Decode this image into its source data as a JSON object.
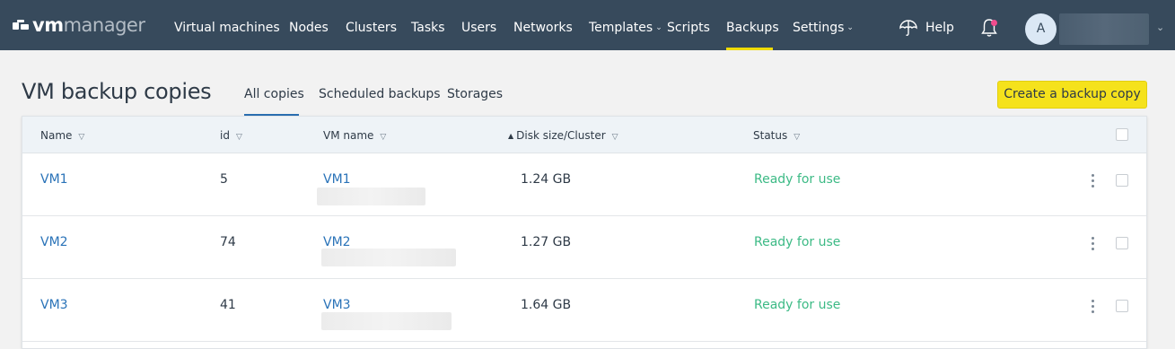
{
  "header": {
    "logo_vm": "vm",
    "logo_manager": "manager",
    "nav": [
      {
        "label": "Virtual machines"
      },
      {
        "label": "Nodes"
      },
      {
        "label": "Clusters"
      },
      {
        "label": "Tasks"
      },
      {
        "label": "Users"
      },
      {
        "label": "Networks"
      },
      {
        "label": "Templates",
        "dropdown": true
      },
      {
        "label": "Scripts"
      },
      {
        "label": "Backups",
        "active": true
      },
      {
        "label": "Settings",
        "dropdown": true
      }
    ],
    "help_label": "Help",
    "avatar_initial": "A",
    "notification_dot_color": "#f24c8e",
    "accent_color": "#f0dc00",
    "bar_color": "#374a5c"
  },
  "page": {
    "title": "VM backup copies",
    "tabs": [
      {
        "label": "All copies",
        "active": true
      },
      {
        "label": "Scheduled backups"
      },
      {
        "label": "Storages"
      }
    ],
    "create_button": "Create a backup copy"
  },
  "table": {
    "columns": [
      "Name",
      "id",
      "VM name",
      "Disk size/Cluster",
      "Status"
    ],
    "sorted_column": "Disk size/Cluster",
    "sort_direction": "ascending",
    "rows": [
      {
        "name": "VM1",
        "id": "5",
        "vm_name": "VM1",
        "disk_size": "1.24 GB",
        "status": "Ready for use"
      },
      {
        "name": "VM2",
        "id": "74",
        "vm_name": "VM2",
        "disk_size": "1.27 GB",
        "status": "Ready for use"
      },
      {
        "name": "VM3",
        "id": "41",
        "vm_name": "VM3",
        "disk_size": "1.64 GB",
        "status": "Ready for use"
      }
    ],
    "status_color": "#3cba85",
    "link_color": "#2a73b8"
  }
}
